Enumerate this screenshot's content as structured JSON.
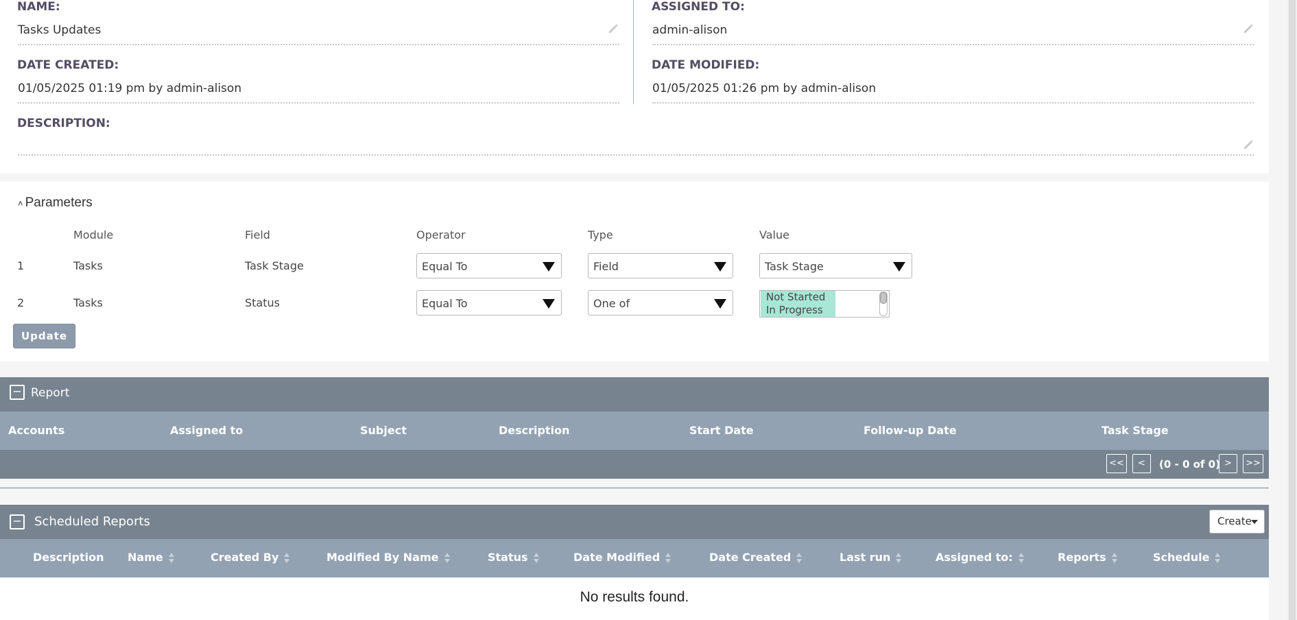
{
  "detail": {
    "name_label": "NAME:",
    "name_value": "Tasks Updates",
    "assigned_label": "ASSIGNED TO:",
    "assigned_value": "admin-alison",
    "created_label": "DATE CREATED:",
    "created_value": "01/05/2025 01:19 pm by admin-alison",
    "modified_label": "DATE MODIFIED:",
    "modified_value": "01/05/2025 01:26 pm by admin-alison",
    "description_label": "DESCRIPTION:",
    "description_value": ""
  },
  "parameters": {
    "title": "Parameters",
    "headers": {
      "module": "Module",
      "field": "Field",
      "operator": "Operator",
      "type": "Type",
      "value": "Value"
    },
    "rows": [
      {
        "num": "1",
        "module": "Tasks",
        "field": "Task Stage",
        "operator": "Equal To",
        "type": "Field",
        "value": "Task Stage"
      },
      {
        "num": "2",
        "module": "Tasks",
        "field": "Status",
        "operator": "Equal To",
        "type": "One of",
        "values": [
          "Not Started",
          "In Progress"
        ]
      }
    ],
    "update_label": "Update"
  },
  "report": {
    "toggle": "−",
    "title": "Report",
    "columns": [
      "Accounts",
      "Assigned to",
      "Subject",
      "Description",
      "Start Date",
      "Follow-up Date",
      "Task Stage"
    ],
    "pagination": {
      "first": "<<",
      "prev": "<",
      "info": "(0 - 0 of 0)",
      "next": ">",
      "last": ">>"
    }
  },
  "scheduled": {
    "toggle": "−",
    "title": "Scheduled Reports",
    "create_label": "Create",
    "columns": [
      "Description",
      "Name",
      "Created By",
      "Modified By Name",
      "Status",
      "Date Modified",
      "Date Created",
      "Last run",
      "Assigned to:",
      "Reports",
      "Schedule"
    ],
    "empty_message": "No results found."
  },
  "colors": {
    "header_bar": "#778490",
    "column_bar": "#92a2b3",
    "selected_option": "#a8e6d5",
    "update_button": "#8d9aab"
  }
}
